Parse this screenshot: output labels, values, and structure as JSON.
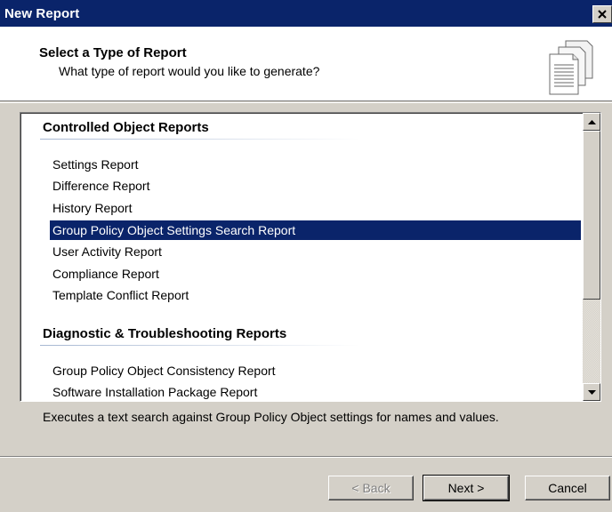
{
  "window": {
    "title": "New Report",
    "close_glyph": "✕"
  },
  "header": {
    "title": "Select a Type of Report",
    "subtitle": "What type of report would you like to generate?",
    "icon": "report-pages-icon"
  },
  "report_list": {
    "groups": [
      {
        "label": "Controlled Object Reports",
        "items": [
          "Settings Report",
          "Difference Report",
          "History Report",
          "Group Policy Object Settings Search Report",
          "User Activity Report",
          "Compliance Report",
          "Template Conflict Report"
        ]
      },
      {
        "label": "Diagnostic & Troubleshooting Reports",
        "items": [
          "Group Policy Object Consistency Report",
          "Software Installation Package Report"
        ]
      }
    ],
    "selected_item": "Group Policy Object Settings Search Report"
  },
  "description": "Executes a text search against Group Policy Object settings for names and values.",
  "buttons": {
    "back": "< Back",
    "next": "Next >",
    "cancel": "Cancel"
  },
  "colors": {
    "selection": "#0a246a",
    "titlebar": "#0a246a",
    "dialog_face": "#d4d0c8"
  }
}
